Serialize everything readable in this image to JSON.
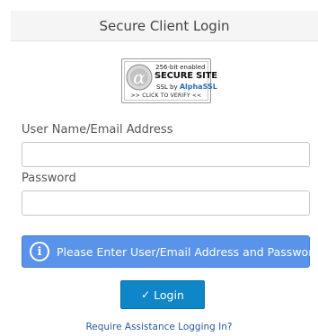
{
  "header": {
    "title": "Secure Client Login"
  },
  "ssl_badge": {
    "line1": "256-bit enabled",
    "line2": "SECURE SITE",
    "line3_prefix": "SSL by ",
    "line3_brand": "AlphaSSL",
    "line4": ">> CLICK TO VERIFY <<"
  },
  "form": {
    "username_label": "User Name/Email Address",
    "username_value": "",
    "password_label": "Password",
    "password_value": ""
  },
  "alert": {
    "message": "Please Enter User/Email Address and Password",
    "color": "#5a93ea"
  },
  "login_button": {
    "label": "Login",
    "check_glyph": "✓",
    "color": "#0f86c8"
  },
  "help_link": {
    "label": "Require Assistance Logging In?"
  }
}
